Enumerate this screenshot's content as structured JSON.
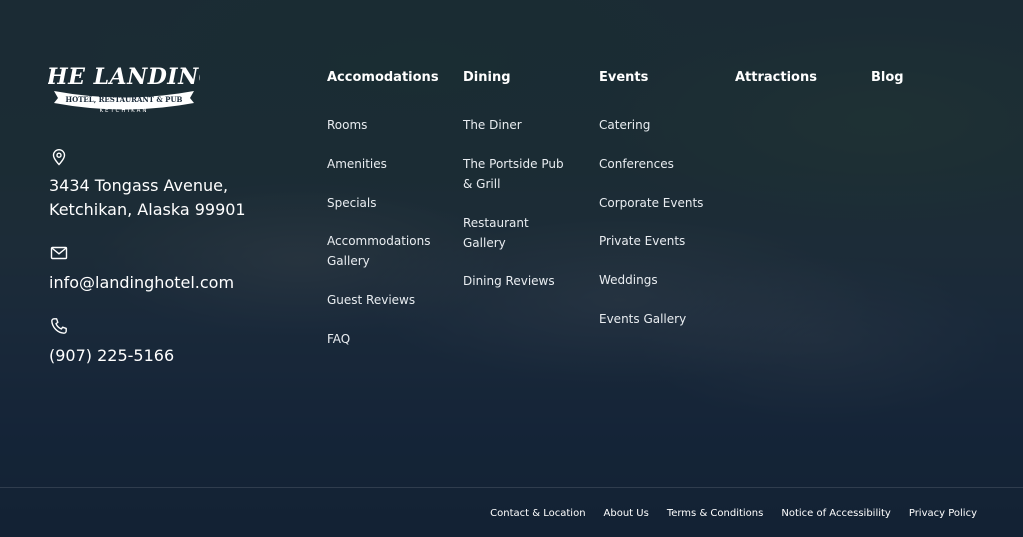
{
  "brand": {
    "logo_main": "THE LANDING",
    "logo_ribbon": "HOTEL, RESTAURANT & PUB",
    "logo_city": "KETCHIKAN"
  },
  "contact": {
    "address_icon": "map-pin-icon",
    "address_line1": "3434 Tongass Avenue,",
    "address_line2": "Ketchikan, Alaska 99901",
    "email_icon": "envelope-icon",
    "email": "info@landinghotel.com",
    "phone_icon": "phone-icon",
    "phone": "(907) 225-5166"
  },
  "nav": {
    "accomodations": {
      "title": "Accomodations",
      "items": [
        "Rooms",
        "Amenities",
        "Specials",
        "Accommodations Gallery",
        "Guest Reviews",
        "FAQ"
      ]
    },
    "dining": {
      "title": "Dining",
      "items": [
        "The Diner",
        "The Portside Pub & Grill",
        "Restaurant Gallery",
        "Dining Reviews"
      ]
    },
    "events": {
      "title": "Events",
      "items": [
        "Catering",
        "Conferences",
        "Corporate Events",
        "Private Events",
        "Weddings",
        "Events Gallery"
      ]
    },
    "attractions": {
      "title": "Attractions"
    },
    "blog": {
      "title": "Blog"
    }
  },
  "footer": {
    "links": [
      "Contact & Location",
      "About Us",
      "Terms & Conditions",
      "Notice of Accessibility",
      "Privacy Policy"
    ]
  },
  "colors": {
    "overlay": "#122030",
    "text": "#ffffff"
  }
}
